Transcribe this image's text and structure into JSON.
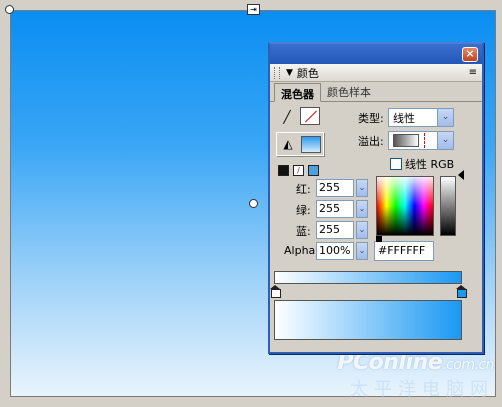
{
  "canvas": {
    "gradient_top": "#0a8ef2",
    "gradient_bottom": "#e9f4fc",
    "top_handle_glyph": "⇥"
  },
  "panel": {
    "close_label": "×",
    "collapse_glyph": "▼",
    "title": "颜色",
    "menu_glyph": "≡",
    "tabs": [
      {
        "label": "混色器",
        "active": true
      },
      {
        "label": "颜色样本",
        "active": false
      }
    ],
    "stroke_tool_glyph": "╱",
    "fill_tool_glyph": "◭",
    "type_label": "类型:",
    "type_value": "线性",
    "overflow_label": "溢出:",
    "linear_rgb_label": "线性 RGB",
    "linear_rgb_checked": false,
    "dropdown_arrow": "⌄",
    "stepper_arrow": "⌄",
    "red_label": "红:",
    "red_value": "255",
    "green_label": "绿:",
    "green_value": "255",
    "blue_label": "蓝:",
    "blue_value": "255",
    "alpha_label": "Alpha:",
    "alpha_value": "100%",
    "hex_value": "#FFFFFF",
    "gradient": {
      "stops": [
        "#ffffff",
        "#1a98f2"
      ]
    }
  },
  "watermark": {
    "brand": "PConline",
    "brand_suffix": ".com.cn",
    "chinese": "太平洋电脑网"
  }
}
